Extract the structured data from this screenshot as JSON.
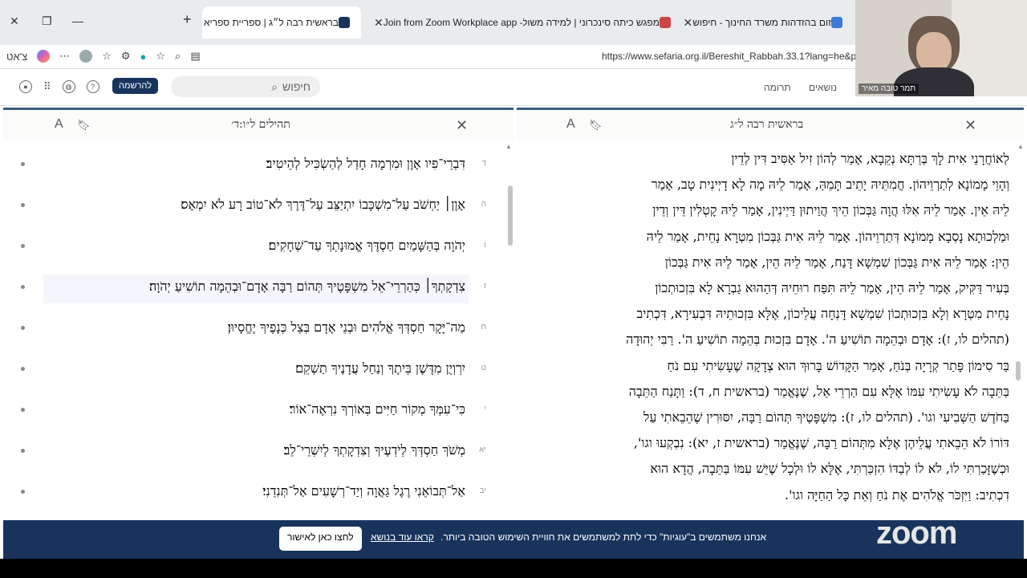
{
  "browser": {
    "tabs": [
      {
        "label": "בראשית רבה ל״ג | ספריית ספריא",
        "active": true
      },
      {
        "label": "Join from Zoom Workplace app - Zoom",
        "active": false
      },
      {
        "label": "מפגש כיתה סינכרוני | למידה משולבת",
        "active": false
      },
      {
        "label": "זום בהזדהות משרד החינוך - חיפוש",
        "active": false
      }
    ],
    "new_tab": "+",
    "profile_label": "צ'אט",
    "url": "https://www.sefaria.org.il/Bereshit_Rabbah.33.1?lang=he&p2="
  },
  "header": {
    "signup": "להרשמה",
    "search_placeholder": "חיפוש",
    "donate": "תרומה",
    "topics": "נושאים"
  },
  "left_panel": {
    "title": "תהילים ל״ו:ד׳",
    "verses": [
      {
        "num": "ד",
        "text": "דִּבְרֵי־פִיו אָוֶן וּמִרְמָה חָדַל לְהַשְׂכִּיל לְהֵיטִיב׃"
      },
      {
        "num": "ה",
        "text": "אָוֶן׀ יַחְשֹׁב עַל־מִשְׁכָּבוֹ יִתְיַצֵּב עַל־דֶּרֶךְ לֹא־טוֹב רָע לֹא יִמְאָס׃"
      },
      {
        "num": "ו",
        "text": "יְהֹוָה בְּהַשָּׁמַיִם חַסְדֶּךָ אֱמוּנָתְךָ עַד־שְׁחָקִים׃"
      },
      {
        "num": "ז",
        "text": "צִדְקָתְךָ׀ כְּהַרְרֵי־אֵל מִשְׁפָּטֶיךָ תְּהוֹם רַבָּה אָדָם־וּבְהֵמָה תוֹשִׁיעַ יְהֹוָה׃"
      },
      {
        "num": "ח",
        "text": "מַה־יָּקָר חַסְדְּךָ אֱלֹהִים וּבְנֵי אָדָם בְּצֵל כְּנָפֶיךָ יֶחֱסָיוּן׃"
      },
      {
        "num": "ט",
        "text": "יִרְוְיֻן מִדֶּשֶׁן בֵּיתֶךָ וְנַחַל עֲדָנֶיךָ תַשְׁקֵם׃"
      },
      {
        "num": "י",
        "text": "כִּי־עִמְּךָ מְקוֹר חַיִּים בְּאוֹרְךָ נִרְאֶה־אוֹר׃"
      },
      {
        "num": "יא",
        "text": "מְשֹׁךְ חַסְדְּךָ לְיֹדְעֶיךָ וְצִדְקָתְךָ לְיִשְׁרֵי־לֵב׃"
      },
      {
        "num": "יב",
        "text": "אַל־תְּבוֹאֵנִי רֶגֶל גַּאֲוָה וְיַד־רְשָׁעִים אַל־תְּנִדֵנִי׃"
      }
    ]
  },
  "right_panel": {
    "title": "בראשית רבה ל״ג",
    "lines": [
      "לְאוֹחֲרָנֵי אִית לָךְ בְּרַתָּא נְקֵבָא, אָמַר לְהוֹן זִיל אַסִּיב דִּין לְדֵין",
      "וְהָוֵי מָמוֹנָא לְתַרְוֵיהוֹן. חֲמִתֵּיהּ יָתֵיב תָּמֵהַּ, אָמַר לֵיהּ מָה לָא דָיְינִית טָב, אָמַר",
      "לֵיהּ אֵין. אָמַר לֵיהּ אִלּוּ הֲוָה גַּבְּכוֹן הֵיךְ הֲוַיתוּן דַּיְינִין, אָמַר לֵיהּ קָטְלִין דֵּין וְדֵין",
      "וּמַלְכוּתָא נָסְבָא מָמוֹנָא דְּתַרְוֵיהוֹן. אָמַר לֵיהּ אִית גַּבְּכוֹן מִטְרָא נָחֵית, אָמַר לֵיהּ",
      "הֵין: אָמַר לֵיהּ אִית גַּבְּכוֹן שִׁמְשָׁא דָּנַח, אָמַר לֵיהּ הֵין, אָמַר לֵיהּ אִית גַּבְּכוֹן",
      "בְּעִיר דַּקִּיק, אָמַר לֵיהּ הֵין, אָמַר לֵיהּ תִּפַּח רוּחֵיהּ דְּהַהוּא גַבְרָא לָא בִּזְכוּתְכוֹן",
      "נָחֵית מִטְרָא וְלָא בִּזְכוּתְכוֹן שִׁמְשָׁא דָּנְחָה עֲלֵיכוֹן, אֶלָּא בִּזְכוּתֵיהּ דִּבְעִירָא, דִּכְתִיב",
      "(תהלים לו, ז): אָדָם וּבְהֵמָה תוֹשִׁיעַ ה'. אָדָם בִּזְכוּת בְּהֵמָה תוֹשִׁיעַ ה'. רַבִּי יְהוּדָה",
      "בַּר סִימוֹן פָּתַר קְרָיָה בְּנֹחַ, אָמַר הַקָּדוֹשׁ בָּרוּךְ הוּא צְדָקָה שֶׁעָשִׂיתִי עִם נֹחַ",
      "בַּתֵּבָה לֹא עָשִׂיתִי עִמּוֹ אֶלָּא עִם הַרְרֵי אֵל, שֶׁנֶּאֱמַר (בראשית ח, ד): וַתָּנַח הַתֵּבָה",
      "בַּחֹדֶשׁ הַשְּׁבִיעִי וגו'. (תהלים לו, ז): מִשְׁפָּטֶיךָ תְּהוֹם רַבָּה, יִסּוּרִין שֶׁהֵבֵאתִי עַל",
      "דּוֹרוֹ לֹא הֵבֵאתִי עֲלֵיהֶן אֶלָּא מִתְּהוֹם רַבָּה, שֶׁנֶּאֱמַר (בראשית ז, יא): נִבְקְעוּ וגו',",
      "וּכְשֶׁזָּכַרְתִּי לוֹ, לֹא לוֹ לְבַדּוֹ הִזְכַּרְתִּי, אֶלָּא לוֹ וּלְכָל שֶׁיֵּשׁ עִמּוֹ בַּתֵּבָה, הֲדָא הוּא",
      "דִכְתִיב: וַיִּזְכֹּר אֱלֹהִים אֶת נֹחַ וְאֵת כָּל הַחַיָּה וגו'."
    ]
  },
  "cookie": {
    "text": "אנחנו משתמשים ב\"עוגיות\" כדי לתת למשתמשים את חוויית השימוש הטובה ביותר.",
    "link": "קראו עוד בנושא",
    "button": "לחצו כאן לאישור"
  },
  "zoom_logo": "zoom",
  "video": {
    "name": "תמר טובה מאיר"
  },
  "colors": {
    "brand_blue": "#18345d",
    "accent": "#3b5b84"
  }
}
